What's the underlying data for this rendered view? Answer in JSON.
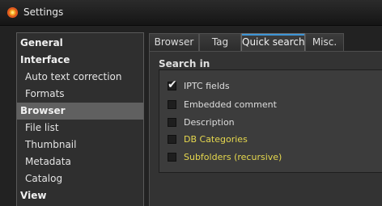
{
  "window": {
    "title": "Settings"
  },
  "sidebar": {
    "items": [
      {
        "label": "General",
        "kind": "section"
      },
      {
        "label": "Interface",
        "kind": "section"
      },
      {
        "label": "Auto text correction",
        "kind": "item"
      },
      {
        "label": "Formats",
        "kind": "item"
      },
      {
        "label": "Browser",
        "kind": "section",
        "selected": true
      },
      {
        "label": "File list",
        "kind": "item"
      },
      {
        "label": "Thumbnail",
        "kind": "item"
      },
      {
        "label": "Metadata",
        "kind": "item"
      },
      {
        "label": "Catalog",
        "kind": "item"
      },
      {
        "label": "View",
        "kind": "section"
      }
    ]
  },
  "tabs": [
    {
      "label": "Browser",
      "active": false
    },
    {
      "label": "Tag",
      "active": false
    },
    {
      "label": "Quick search",
      "active": true
    },
    {
      "label": "Misc.",
      "active": false
    }
  ],
  "search_in": {
    "title": "Search in",
    "options": [
      {
        "label": "IPTC fields",
        "checked": true,
        "highlight": false
      },
      {
        "label": "Embedded comment",
        "checked": false,
        "highlight": false
      },
      {
        "label": "Description",
        "checked": false,
        "highlight": false
      },
      {
        "label": "DB Categories",
        "checked": false,
        "highlight": true
      },
      {
        "label": "Subfolders (recursive)",
        "checked": false,
        "highlight": true
      }
    ],
    "check_glyph": "✔"
  },
  "colors": {
    "accent": "#3d95d6",
    "highlight_text": "#e6d84e",
    "selected_bg": "#606060"
  },
  "icons": {
    "app": "flower-logo-icon"
  }
}
